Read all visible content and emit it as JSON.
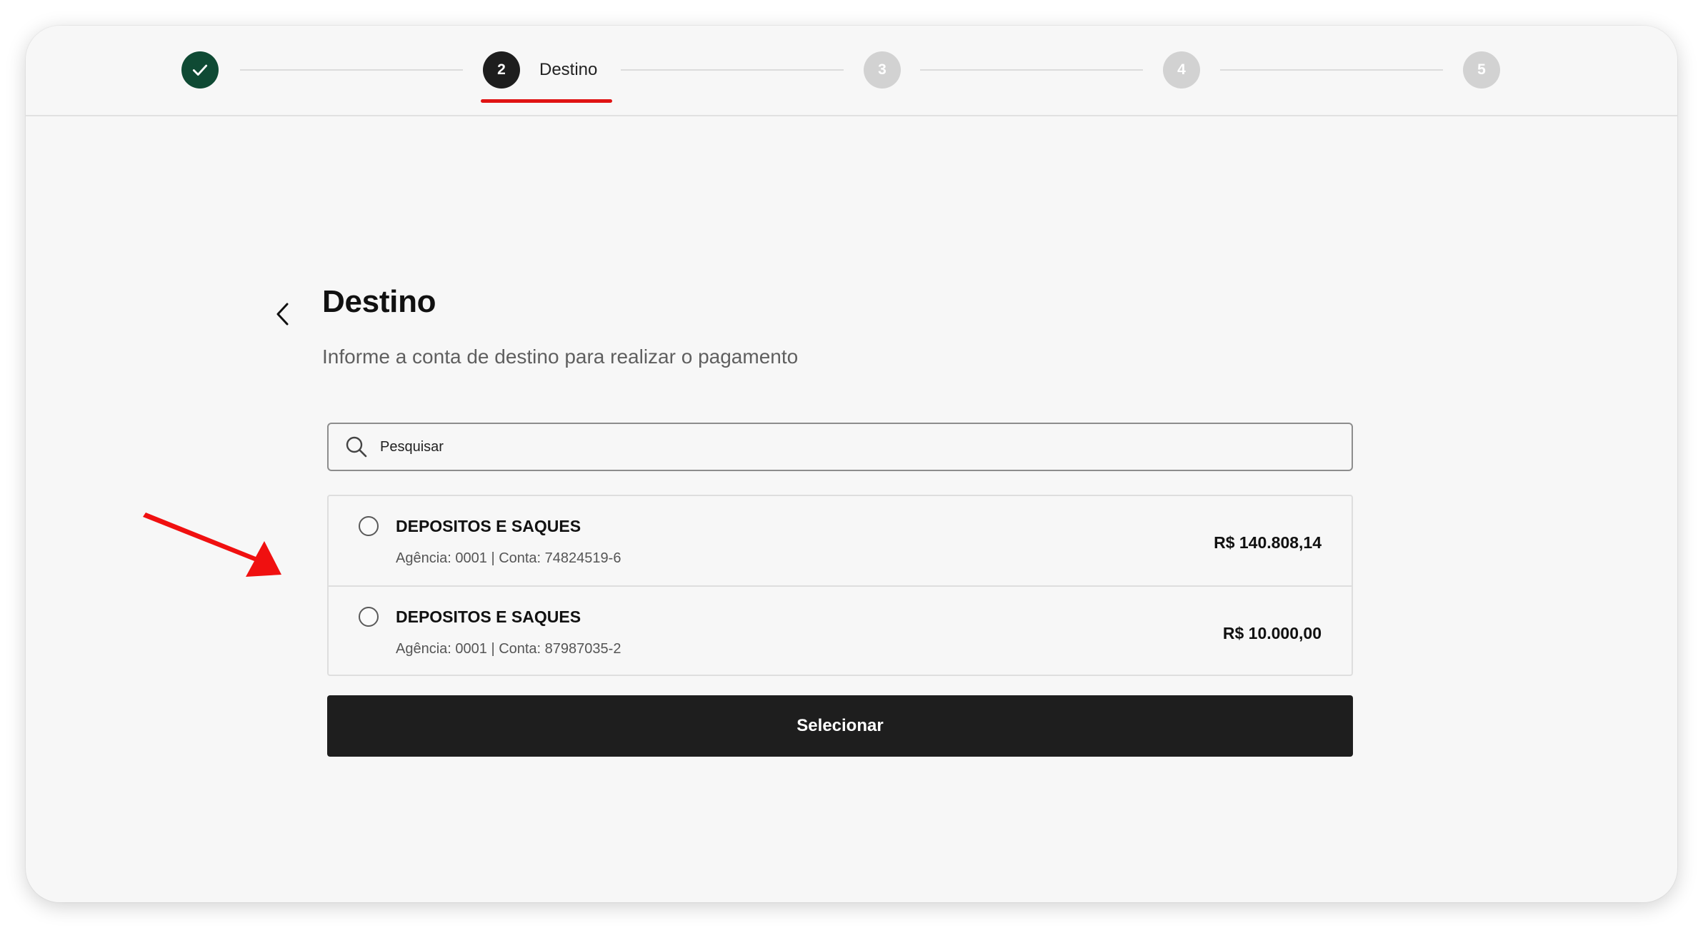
{
  "stepper": {
    "steps": [
      {
        "number": "1",
        "state": "done",
        "label": ""
      },
      {
        "number": "2",
        "state": "current",
        "label": "Destino"
      },
      {
        "number": "3",
        "state": "pending",
        "label": ""
      },
      {
        "number": "4",
        "state": "pending",
        "label": ""
      },
      {
        "number": "5",
        "state": "pending",
        "label": ""
      }
    ],
    "done_icon": "check-icon"
  },
  "page": {
    "title": "Destino",
    "subtitle": "Informe a conta de destino para realizar o pagamento",
    "back_icon": "chevron-left-icon"
  },
  "search": {
    "placeholder": "Pesquisar",
    "value": "",
    "icon": "search-icon"
  },
  "accounts": [
    {
      "name": "DEPOSITOS E SAQUES",
      "details": "Agência: 0001 | Conta: 74824519-6",
      "amount": "R$ 140.808,14",
      "selected": false
    },
    {
      "name": "DEPOSITOS E SAQUES",
      "details": "Agência: 0001 | Conta: 87987035-2",
      "amount": "R$ 10.000,00",
      "selected": false
    }
  ],
  "actions": {
    "select_label": "Selecionar"
  },
  "colors": {
    "step_done": "#0f4a34",
    "step_current": "#1e1e1e",
    "step_pending": "#d2d2d2",
    "active_underline": "#e01414",
    "primary_button": "#1e1e1e",
    "annotation_arrow": "#f01010"
  }
}
